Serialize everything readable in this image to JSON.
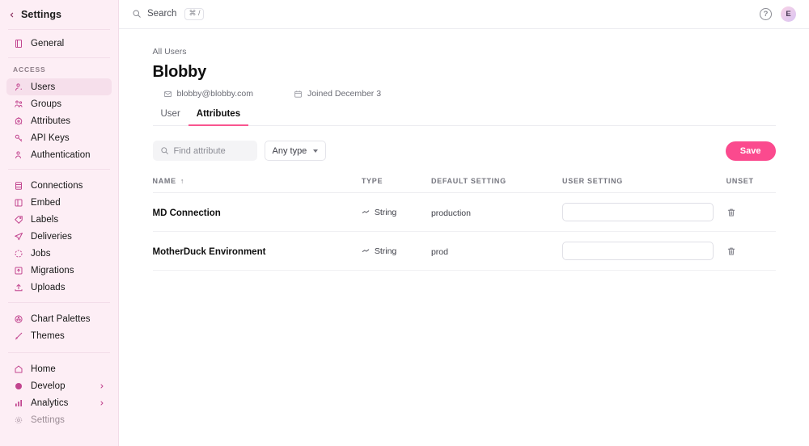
{
  "sidebar": {
    "back_label": "Settings",
    "groups": [
      {
        "items": [
          {
            "label": "General",
            "icon": "book-icon"
          }
        ]
      },
      {
        "section": "ACCESS",
        "items": [
          {
            "label": "Users",
            "icon": "user-icon",
            "active": true
          },
          {
            "label": "Groups",
            "icon": "users-icon"
          },
          {
            "label": "Attributes",
            "icon": "atom-icon"
          },
          {
            "label": "API Keys",
            "icon": "key-icon"
          },
          {
            "label": "Authentication",
            "icon": "user-check-icon"
          }
        ]
      },
      {
        "items": [
          {
            "label": "Connections",
            "icon": "database-icon"
          },
          {
            "label": "Embed",
            "icon": "embed-icon"
          },
          {
            "label": "Labels",
            "icon": "tag-icon"
          },
          {
            "label": "Deliveries",
            "icon": "send-icon"
          },
          {
            "label": "Jobs",
            "icon": "circle-dashed-icon"
          },
          {
            "label": "Migrations",
            "icon": "migration-icon"
          },
          {
            "label": "Uploads",
            "icon": "upload-icon"
          }
        ]
      },
      {
        "items": [
          {
            "label": "Chart Palettes",
            "icon": "palette-icon"
          },
          {
            "label": "Themes",
            "icon": "brush-icon"
          }
        ]
      }
    ],
    "bottom_items": [
      {
        "label": "Home",
        "icon": "home-icon"
      },
      {
        "label": "Develop",
        "icon": "develop-icon",
        "chevron": true
      },
      {
        "label": "Analytics",
        "icon": "chart-icon",
        "chevron": true
      },
      {
        "label": "Settings",
        "icon": "gear-icon",
        "muted": true
      }
    ]
  },
  "topbar": {
    "search_label": "Search",
    "search_shortcut": "⌘ /",
    "help_glyph": "?",
    "avatar_initial": "E"
  },
  "page": {
    "breadcrumb": "All Users",
    "title": "Blobby",
    "email": "blobby@blobby.com",
    "joined": "Joined December 3",
    "tabs": [
      {
        "label": "User",
        "active": false
      },
      {
        "label": "Attributes",
        "active": true
      }
    ]
  },
  "toolbar": {
    "find_placeholder": "Find attribute",
    "type_filter": "Any type",
    "save_label": "Save"
  },
  "table": {
    "columns": [
      "NAME",
      "TYPE",
      "DEFAULT SETTING",
      "USER SETTING",
      "UNSET"
    ],
    "sort_indicator": "↑",
    "rows": [
      {
        "name": "MD Connection",
        "type": "String",
        "default": "production",
        "user_value": "",
        "unset_icon": "trash-icon"
      },
      {
        "name": "MotherDuck Environment",
        "type": "String",
        "default": "prod",
        "user_value": "",
        "unset_icon": "trash-icon"
      }
    ]
  },
  "colors": {
    "sidebar_bg": "#fdeef5",
    "accent_pink": "#fb4a8e",
    "icon_pink": "#c2458f",
    "tab_underline": "#f9558f"
  }
}
